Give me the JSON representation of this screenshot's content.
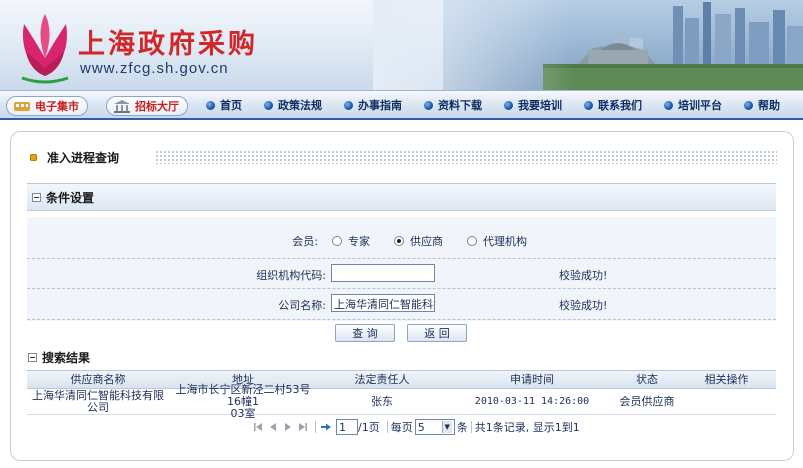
{
  "header": {
    "title": "上海政府采购",
    "url": "www.zfcg.sh.gov.cn"
  },
  "quick_links": [
    {
      "label": "电子集市",
      "icon": "market-icon"
    },
    {
      "label": "招标大厅",
      "icon": "bidding-hall-icon"
    }
  ],
  "nav": [
    {
      "label": "首页"
    },
    {
      "label": "政策法规"
    },
    {
      "label": "办事指南"
    },
    {
      "label": "资料下载"
    },
    {
      "label": "我要培训"
    },
    {
      "label": "联系我们"
    },
    {
      "label": "培训平台"
    },
    {
      "label": "帮助"
    }
  ],
  "page": {
    "title": "准入进程查询"
  },
  "conditions": {
    "section_title": "条件设置",
    "member_label": "会员:",
    "member_options": [
      "专家",
      "供应商",
      "代理机构"
    ],
    "member_selected": "供应商",
    "org_code_label": "组织机构代码:",
    "org_code_value": "",
    "org_code_status": "校验成功!",
    "company_label": "公司名称:",
    "company_value": "上海华清同仁智能科技有",
    "company_status": "校验成功!",
    "query_button": "查 询",
    "back_button": "返 回"
  },
  "results": {
    "section_title": "搜索结果",
    "columns": [
      "供应商名称",
      "地址",
      "法定责任人",
      "申请时间",
      "状态",
      "相关操作"
    ],
    "rows": [
      {
        "supplier": "上海华清同仁智能科技有限公司",
        "address_line1": "上海市长宁区新泾二村53号16幢1",
        "address_line2": "03室",
        "legal_rep": "张东",
        "apply_time": "2010-03-11 14:26:00",
        "status": "会员供应商",
        "action": ""
      }
    ]
  },
  "pager": {
    "current_page": "1",
    "total_pages_text": "/1页",
    "per_page_label": "每页",
    "per_page_value": "5",
    "per_page_unit": "条",
    "summary": "共1条记录, 显示1到1"
  }
}
